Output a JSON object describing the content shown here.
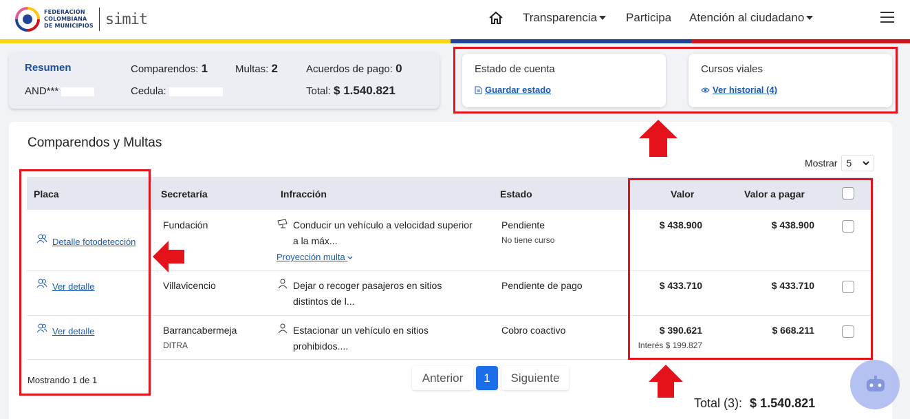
{
  "header": {
    "logo_text_line1": "FEDERACIÓN",
    "logo_text_line2": "COLOMBIANA",
    "logo_text_line3": "DE MUNICIPIOS",
    "logo_brand": "simit",
    "nav": [
      {
        "label": "Transparencia",
        "dropdown": true
      },
      {
        "label": "Participa",
        "dropdown": false
      },
      {
        "label": "Atención al ciudadano",
        "dropdown": true
      }
    ],
    "flag_colors": [
      "#f9d616",
      "#1e4596",
      "#d3121c"
    ]
  },
  "summary": {
    "title": "Resumen",
    "name": "AND***",
    "comparendos_label": "Comparendos:",
    "comparendos_value": "1",
    "multas_label": "Multas:",
    "multas_value": "2",
    "acuerdos_label": "Acuerdos de pago:",
    "acuerdos_value": "0",
    "cedula_label": "Cedula:",
    "total_label": "Total:",
    "total_value": "$ 1.540.821"
  },
  "estado_cuenta": {
    "title": "Estado de cuenta",
    "link": "Guardar estado"
  },
  "cursos": {
    "title": "Cursos viales",
    "link": "Ver historial (4)"
  },
  "panel": {
    "title": "Comparendos y Multas",
    "mostrar_label": "Mostrar",
    "mostrar_value": "5",
    "columns": [
      "Placa",
      "Secretaría",
      "Infracción",
      "Estado",
      "Valor",
      "Valor a pagar"
    ],
    "rows": [
      {
        "placa_link": "Detalle fotodetección",
        "secretaria": "Fundación",
        "secretaria_sub": "",
        "infraccion_l1": "Conducir un vehículo a velocidad superior",
        "infraccion_l2": "a la máx...",
        "proyeccion": "Proyección multa",
        "estado": "Pendiente",
        "estado_sub": "No tiene curso",
        "valor": "$ 438.900",
        "valor_sub": "",
        "valor_pagar": "$ 438.900"
      },
      {
        "placa_link": "Ver detalle",
        "secretaria": "Villavicencio",
        "secretaria_sub": "",
        "infraccion_l1": "Dejar o recoger pasajeros en sitios",
        "infraccion_l2": "distintos de l...",
        "proyeccion": "",
        "estado": "Pendiente de pago",
        "estado_sub": "",
        "valor": "$ 433.710",
        "valor_sub": "",
        "valor_pagar": "$ 433.710"
      },
      {
        "placa_link": "Ver detalle",
        "secretaria": "Barrancabermeja",
        "secretaria_sub": "DITRA",
        "infraccion_l1": "Estacionar un vehículo en sitios",
        "infraccion_l2": "prohibidos....",
        "proyeccion": "",
        "estado": "Cobro coactivo",
        "estado_sub": "",
        "valor": "$ 390.621",
        "valor_sub": "Interés $ 199.827",
        "valor_pagar": "$ 668.211"
      }
    ],
    "showing": "Mostrando 1 de 1",
    "pager": {
      "prev": "Anterior",
      "page": "1",
      "next": "Siguiente"
    },
    "total_label": "Total (3):",
    "total_value": "$ 1.540.821"
  },
  "annotation_color": "#e3121b",
  "accent_color": "#1a6fe8"
}
